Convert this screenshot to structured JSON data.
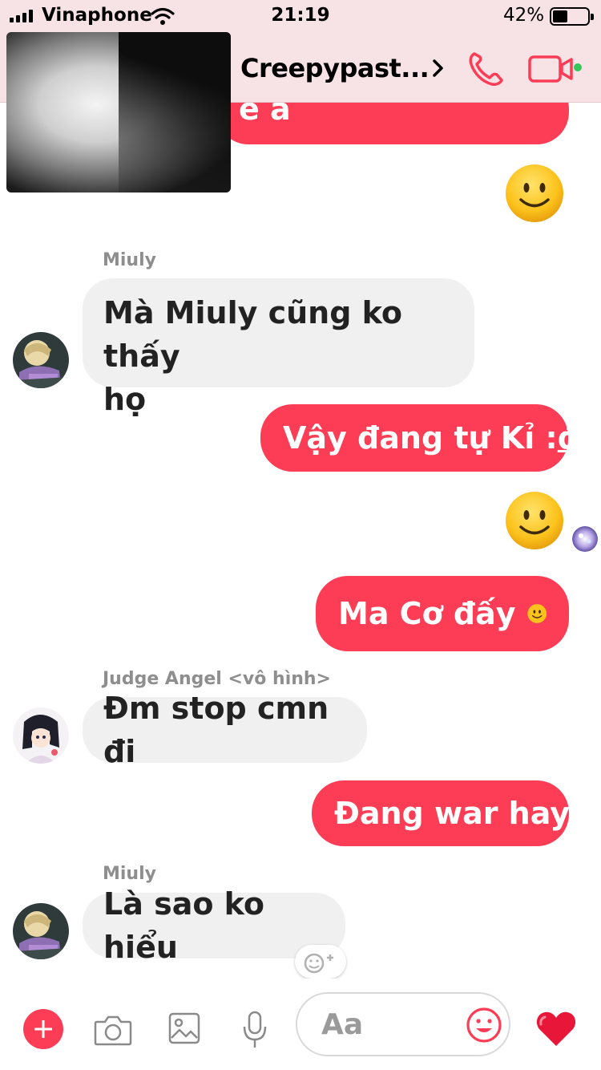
{
  "status_bar": {
    "carrier": "Vinaphone",
    "time": "21:19",
    "battery_percent": "42%",
    "battery_level": 0.42
  },
  "header": {
    "title": "Creepypast...",
    "active_dot_color": "#34c759"
  },
  "colors": {
    "accent": "#fc3d55",
    "incoming_bubble": "#f0f0f0",
    "header_bg": "#f7e3e6"
  },
  "messages": [
    {
      "from": "me",
      "text": "e a",
      "partially_hidden": true
    },
    {
      "from": "me",
      "emoji": "slightly-smiling-face"
    },
    {
      "from": "them",
      "sender": "Miuly",
      "text_line1": "Mà Miuly cũng ko thấy",
      "text_line2": "họ"
    },
    {
      "from": "me",
      "text": "Vậy đang tự Kỉ :",
      "underlined_tail": "đ"
    },
    {
      "from": "me",
      "emoji": "slightly-smiling-face",
      "seen_by_avatar": true
    },
    {
      "from": "me",
      "text": "Ma Cơ đấy",
      "inline_emoji": "slightly-smiling-face"
    },
    {
      "from": "them",
      "sender": "Judge Angel <vô hình>",
      "text": "Đm stop cmn đi"
    },
    {
      "from": "me",
      "text": "Đang war hay"
    },
    {
      "from": "them",
      "sender": "Miuly",
      "text": "Là sao ko hiểu"
    }
  ],
  "composer": {
    "placeholder": "Aa",
    "icons": [
      "plus-icon",
      "camera-icon",
      "image-icon",
      "microphone-icon",
      "emoji-icon",
      "heart-icon"
    ]
  }
}
